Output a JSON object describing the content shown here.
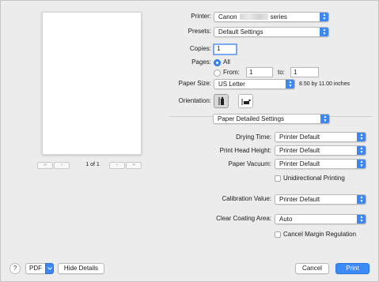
{
  "preview": {
    "page_count": "1 of 1",
    "first_icon": "double-left-icon",
    "prev_icon": "chevron-left-icon",
    "next_icon": "chevron-right-icon",
    "last_icon": "double-right-icon"
  },
  "settings": {
    "printer": {
      "label": "Printer:",
      "value_prefix": "Canon",
      "value_suffix": "series"
    },
    "presets": {
      "label": "Presets:",
      "value": "Default Settings"
    },
    "copies": {
      "label": "Copies:",
      "value": "1"
    },
    "pages": {
      "label": "Pages:",
      "all": "All",
      "from": "From:",
      "from_value": "1",
      "to": "to:",
      "to_value": "1"
    },
    "paper_size": {
      "label": "Paper Size:",
      "value": "US Letter",
      "dims": "8.50 by 11.00 inches"
    },
    "orientation": {
      "label": "Orientation:"
    },
    "section": {
      "value": "Paper Detailed Settings"
    }
  },
  "detail": {
    "drying_time": {
      "label": "Drying Time:",
      "value": "Printer Default"
    },
    "head_height": {
      "label": "Print Head Height:",
      "value": "Printer Default"
    },
    "vacuum": {
      "label": "Paper Vacuum:",
      "value": "Printer Default"
    },
    "unidirectional": "Unidirectional Printing",
    "calibration": {
      "label": "Calibration Value:",
      "value": "Printer Default"
    },
    "coating": {
      "label": "Clear Coating Area:",
      "value": "Auto"
    },
    "cancel_margin": "Cancel Margin Regulation"
  },
  "footer": {
    "help": "?",
    "pdf": "PDF",
    "hide_details": "Hide Details",
    "cancel": "Cancel",
    "print": "Print"
  },
  "colors": {
    "accent": "#3b87f3"
  }
}
